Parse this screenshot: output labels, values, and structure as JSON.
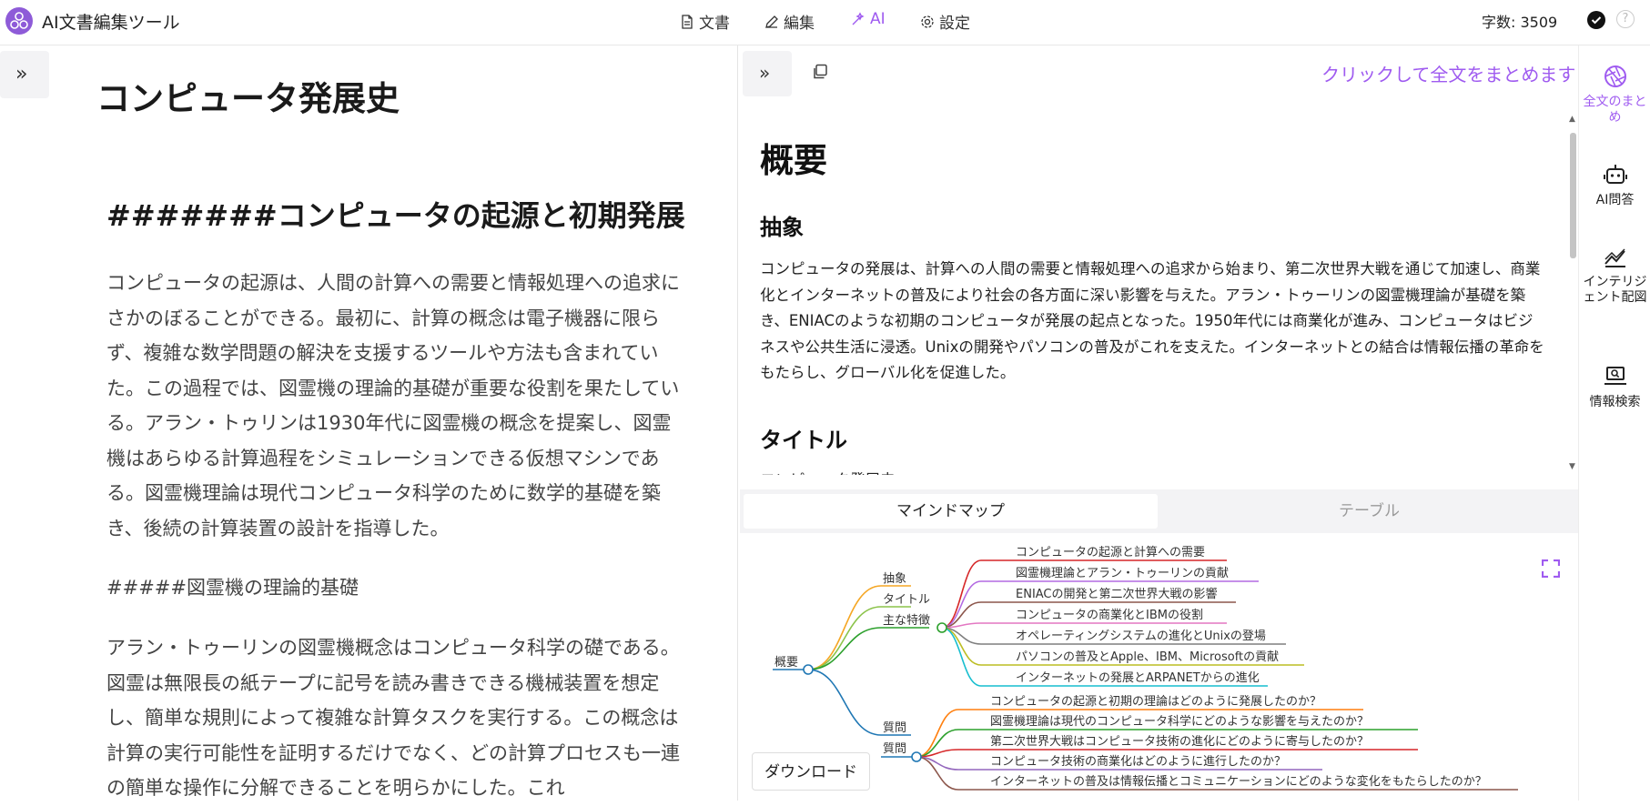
{
  "app": {
    "title": "AI文書編集ツール"
  },
  "nav": [
    {
      "label": "文書",
      "icon": "document-icon",
      "active": false
    },
    {
      "label": "編集",
      "icon": "pencil-icon",
      "active": false
    },
    {
      "label": "AI",
      "icon": "magic-wand-icon",
      "active": true
    },
    {
      "label": "設定",
      "icon": "gear-icon",
      "active": false
    }
  ],
  "header": {
    "word_count": "字数:  3509"
  },
  "editor": {
    "title": "コンピュータ発展史",
    "heading": "#######コンピュータの起源と初期発展",
    "para1": "コンピュータの起源は、人間の計算への需要と情報処理への追求にさかのぼることができる。最初に、計算の概念は電子機器に限らず、複雑な数学問題の解決を支援するツールや方法も含まれていた。この過程では、図霊機の理論的基礎が重要な役割を果たしている。アラン・トゥリンは1930年代に図霊機の概念を提案し、図霊機はあらゆる計算過程をシミュレーションできる仮想マシンである。図霊機理論は現代コンピュータ科学のために数学的基礎を築き、後続の計算装置の設計を指導した。",
    "subheading": "#####図霊機の理論的基礎",
    "para2": "アラン・トゥーリンの図霊機概念はコンピュータ科学の礎である。図霊は無限長の紙テープに記号を読み書きできる機械装置を想定し、簡単な規則によって複雑な計算タスクを実行する。この概念は計算の実行可能性を証明するだけでなく、どの計算プロセスも一連の簡単な操作に分解できることを明らかにした。これ"
  },
  "summary_panel": {
    "summarize_link": "クリックして全文をまとめます",
    "h1": "概要",
    "abstract_heading": "抽象",
    "abstract_text": "コンピュータの発展は、計算への人間の需要と情報処理への追求から始まり、第二次世界大戦を通じて加速し、商業化とインターネットの普及により社会の各方面に深い影響を与えた。アラン・トゥーリンの図霊機理論が基礎を築き、ENIACのような初期のコンピュータが発展の起点となった。1950年代には商業化が進み、コンピュータはビジネスや公共生活に浸透。Unixの開発やパソコンの普及がこれを支えた。インターネットとの結合は情報伝播の革命をもたらし、グローバル化を促進した。",
    "title_heading": "タイトル",
    "title_cutoff": "コンピュータ発展史"
  },
  "tabs": {
    "mindmap": "マインドマップ",
    "table": "テーブル"
  },
  "mindmap": {
    "root": "概要",
    "branches": [
      {
        "label": "抽象",
        "color": "#f5a623"
      },
      {
        "label": "タイトル",
        "color": "#8bc34a"
      },
      {
        "label": "主な特徴",
        "color": "#2ca02c"
      },
      {
        "label": "質問",
        "color": "#1f77b4"
      }
    ],
    "features": [
      {
        "label": "コンピュータの起源と計算への需要",
        "color": "#d62728"
      },
      {
        "label": "図霊機理論とアラン・トゥーリンの貢献",
        "color": "#b36ae2"
      },
      {
        "label": "ENIACの開発と第二次世界大戦の影響",
        "color": "#8c564b"
      },
      {
        "label": "コンピュータの商業化とIBMの役割",
        "color": "#e377c2"
      },
      {
        "label": "オペレーティングシステムの進化とUnixの登場",
        "color": "#7f7f7f"
      },
      {
        "label": "パソコンの普及とApple、IBM、Microsoftの貢献",
        "color": "#bcbd22"
      },
      {
        "label": "インターネットの発展とARPANETからの進化",
        "color": "#17becf"
      }
    ],
    "questions": [
      {
        "label": "コンピュータの起源と初期の理論はどのように発展したのか？",
        "color": "#ff7f0e"
      },
      {
        "label": "図霊機理論は現代のコンピュータ科学にどのような影響を与えたのか？",
        "color": "#2ca02c"
      },
      {
        "label": "第二次世界大戦はコンピュータ技術の進化にどのように寄与したのか？",
        "color": "#d62728"
      },
      {
        "label": "コンピュータ技術の商業化はどのように進行したのか？",
        "color": "#9467bd"
      },
      {
        "label": "インターネットの普及は情報伝播とコミュニケーションにどのような変化をもたらしたのか？",
        "color": "#8c564b"
      }
    ],
    "download_label": "ダウンロード"
  },
  "right_panel": [
    {
      "label": "全文のまとめ",
      "icon": "aperture-icon",
      "active": true
    },
    {
      "label": "AI問答",
      "icon": "robot-icon",
      "active": false
    },
    {
      "label": "インテリジェント配図",
      "icon": "chart-icon",
      "active": false
    },
    {
      "label": "情報検索",
      "icon": "laptop-search-icon",
      "active": false
    }
  ],
  "colors": {
    "accent": "#9f5bf0"
  }
}
